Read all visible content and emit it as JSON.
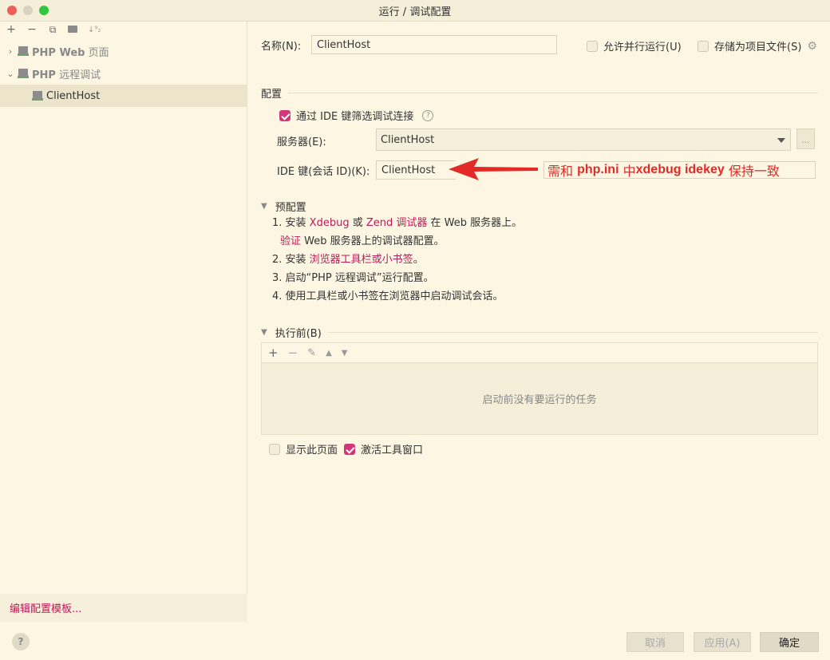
{
  "window": {
    "title": "运行 / 调试配置"
  },
  "left": {
    "toolbar": [
      {
        "name": "add-icon",
        "glyph": "+"
      },
      {
        "name": "remove-icon",
        "glyph": "−"
      },
      {
        "name": "copy-icon",
        "glyph": "⧉"
      },
      {
        "name": "new-folder-icon",
        "glyph": "📁"
      },
      {
        "name": "sort-icon",
        "glyph": "↓⁹₂"
      }
    ],
    "tree": {
      "group1_bold": "PHP Web",
      "group1_rest": " 页面",
      "group2_bold": "PHP",
      "group2_rest": " 远程调试",
      "child": "ClientHost"
    },
    "footer_link": "编辑配置模板..."
  },
  "form": {
    "name_label": "名称(N):",
    "name_value": "ClientHost",
    "allow_parallel": "允许并行运行(U)",
    "store_as_project": "存储为项目文件(S)"
  },
  "config": {
    "section": "配置",
    "filter_ide": "通过 IDE 键筛选调试连接",
    "server_label": "服务器(E):",
    "server_value": "ClientHost",
    "ide_key_label": "IDE 键(会话 ID)(K):",
    "ide_key_value": "ClientHost",
    "dots": "..."
  },
  "annotation": {
    "p1": "需和 ",
    "b1": "php.ini",
    "p2": " 中",
    "b2": "xdebug idekey",
    "p3": " 保持一致",
    "color": "#e22b26"
  },
  "preconfig": {
    "section": "预配置",
    "line1_a": "1. 安装 ",
    "line1_link1": "Xdebug",
    "line1_b": " 或 ",
    "line1_link2": "Zend 调试器",
    "line1_c": " 在 Web 服务器上。",
    "line2_link": "验证",
    "line2_rest": " Web 服务器上的调试器配置。",
    "line3_a": "2. 安装 ",
    "line3_link": "浏览器工具栏或小书签",
    "line3_b": "。",
    "line4": "3. 启动“PHP 远程调试”运行配置。",
    "line5": "4. 使用工具栏或小书签在浏览器中启动调试会话。"
  },
  "before_launch": {
    "section": "执行前(B)",
    "empty_text": "启动前没有要运行的任务",
    "show_page": "显示此页面",
    "activate_window": "激活工具窗口"
  },
  "buttons": {
    "cancel": "取消",
    "apply": "应用(A)",
    "ok": "确定",
    "help": "?"
  },
  "colors": {
    "accent": "#d1377b",
    "link": "#c2185b",
    "background": "#fdf6e3"
  }
}
